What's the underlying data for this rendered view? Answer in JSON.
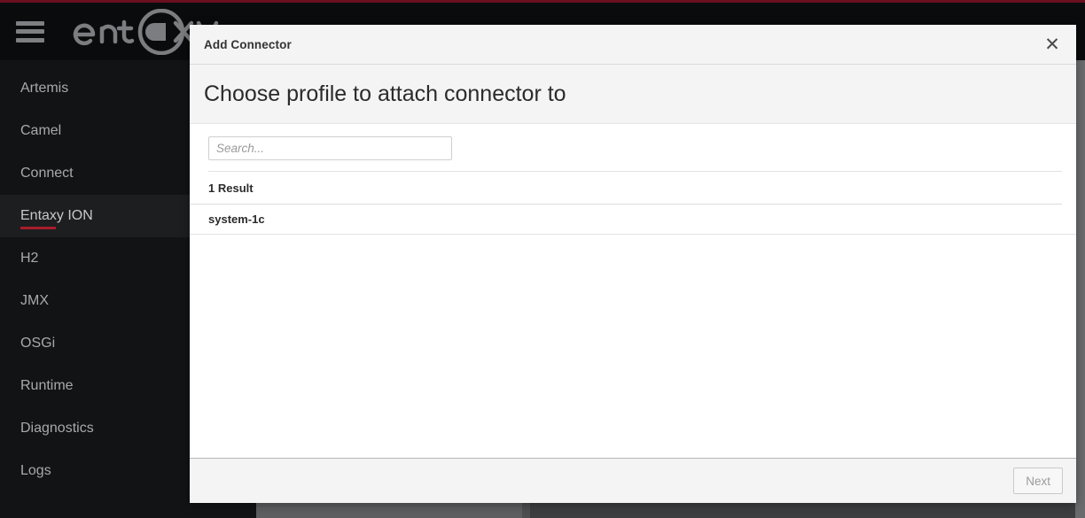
{
  "app": {
    "brand_name": "entaxy",
    "menu_icon": "hamburger-menu-icon",
    "accent_color": "#a61c2b"
  },
  "sidebar": {
    "items": [
      {
        "label": "Artemis",
        "active": false
      },
      {
        "label": "Camel",
        "active": false
      },
      {
        "label": "Connect",
        "active": false
      },
      {
        "label": "Entaxy ION",
        "active": true
      },
      {
        "label": "H2",
        "active": false
      },
      {
        "label": "JMX",
        "active": false
      },
      {
        "label": "OSGi",
        "active": false
      },
      {
        "label": "Runtime",
        "active": false
      },
      {
        "label": "Diagnostics",
        "active": false
      },
      {
        "label": "Logs",
        "active": false
      }
    ]
  },
  "modal": {
    "title": "Add Connector",
    "close_icon": "close-icon",
    "heading": "Choose profile to attach connector to",
    "search": {
      "placeholder": "Search...",
      "value": ""
    },
    "result_count": "1 Result",
    "results": [
      {
        "label": "system-1c"
      }
    ],
    "footer": {
      "next_label": "Next",
      "next_disabled": true
    }
  }
}
